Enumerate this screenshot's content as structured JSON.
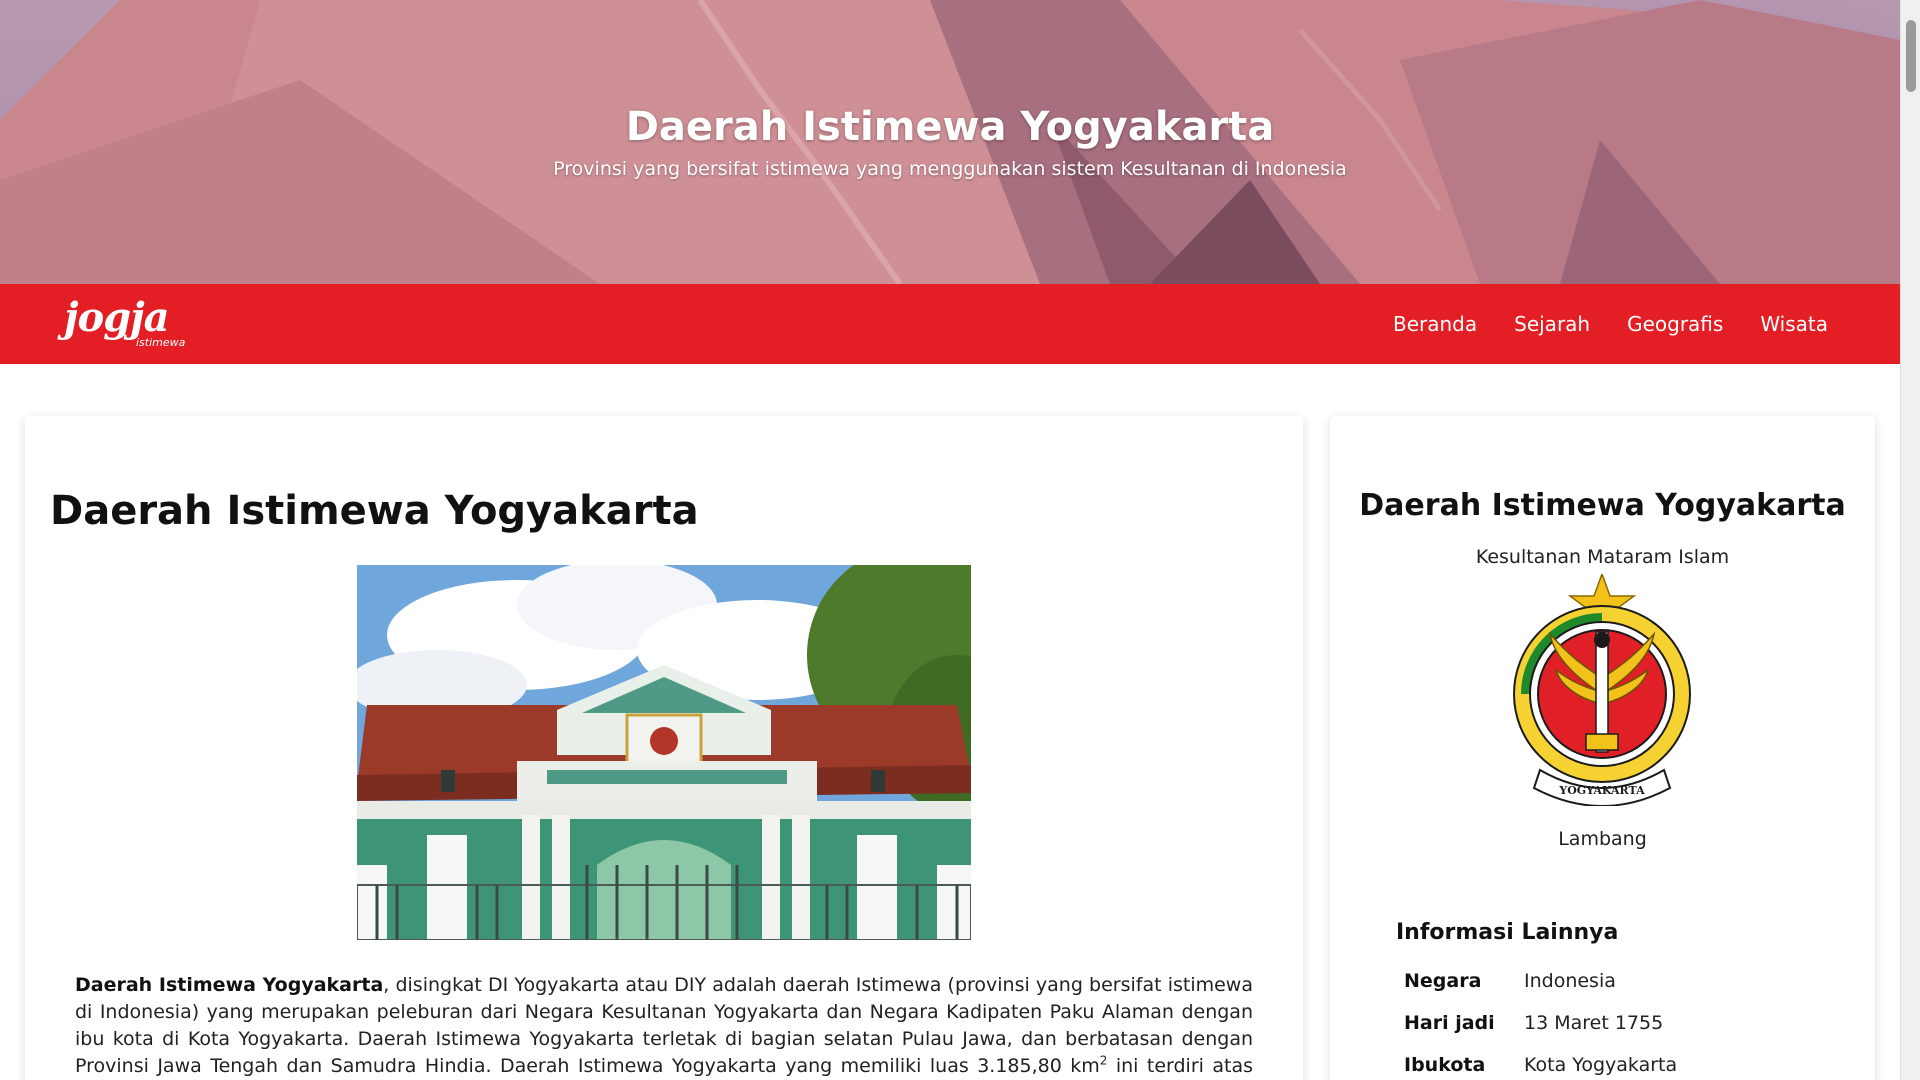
{
  "hero": {
    "title": "Daerah Istimewa Yogyakarta",
    "subtitle": "Provinsi yang bersifat istimewa yang menggunakan sistem Kesultanan di Indonesia"
  },
  "navbar": {
    "logo_text": "jogja",
    "logo_subtext": "istimewa",
    "links": [
      "Beranda",
      "Sejarah",
      "Geografis",
      "Wisata"
    ],
    "color": "#e31e24"
  },
  "main": {
    "title": "Daerah Istimewa Yogyakarta",
    "article": {
      "bold_lead": "Daerah Istimewa Yogyakarta",
      "text_1": ", disingkat DI Yogyakarta atau DIY adalah daerah Istimewa (provinsi yang bersifat istimewa di Indonesia) yang merupakan peleburan dari Negara Kesultanan Yogyakarta dan Negara Kadipaten Paku Alaman dengan ibu kota di Kota Yogyakarta. Daerah Istimewa Yogyakarta terletak di bagian selatan Pulau Jawa, dan berbatasan dengan Provinsi Jawa Tengah dan Samudra Hindia. Daerah Istimewa Yogyakarta yang memiliki luas 3.185,80 km",
      "superscript": "2",
      "text_2": " ini terdiri atas satu kota, dan empat kabupaten,"
    }
  },
  "sidebar": {
    "title": "Daerah Istimewa Yogyakarta",
    "subtitle": "Kesultanan Mataram Islam",
    "emblem_caption": "Lambang",
    "emblem_ribbon_text": "YOGYAKARTA",
    "info_heading": "Informasi Lainnya",
    "info": [
      {
        "key": "Negara",
        "value": "Indonesia"
      },
      {
        "key": "Hari jadi",
        "value": "13 Maret 1755"
      },
      {
        "key": "Ibukota",
        "value": "Kota Yogyakarta"
      }
    ]
  }
}
